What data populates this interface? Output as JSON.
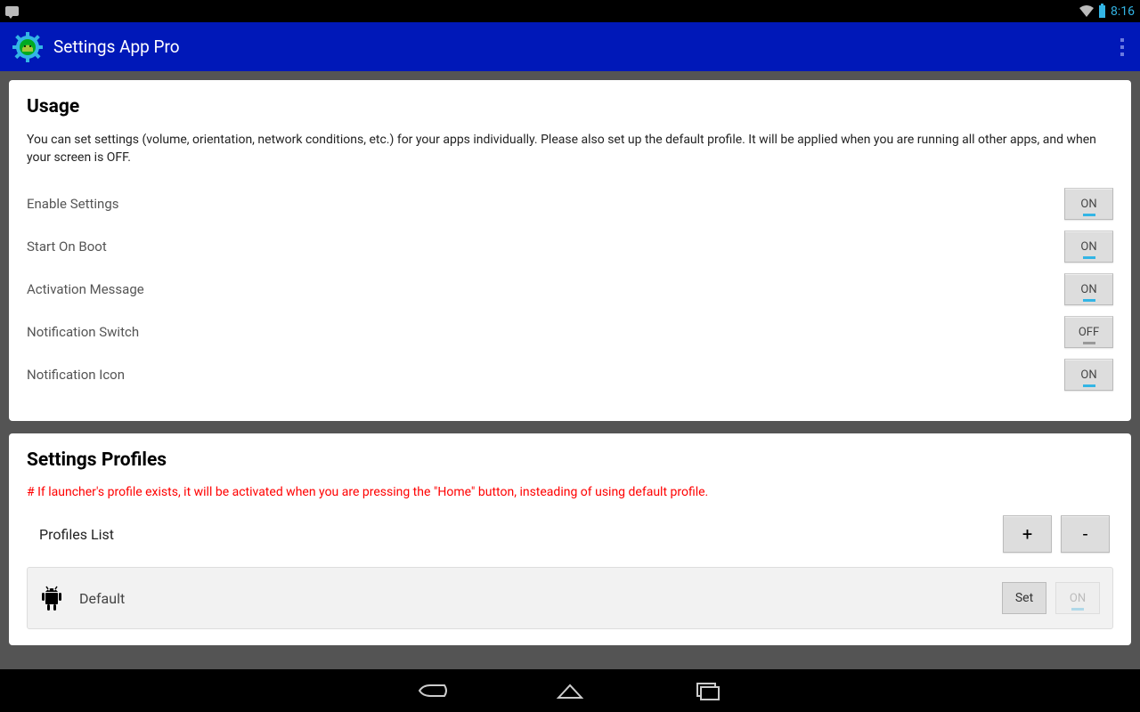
{
  "status": {
    "time": "8:16"
  },
  "appbar": {
    "title": "Settings App Pro"
  },
  "usage": {
    "heading": "Usage",
    "description": "You can set settings (volume, orientation, network conditions, etc.) for your apps individually. Please also set up the default profile. It will be applied when you are running all other apps, and when your screen is OFF.",
    "items": [
      {
        "label": "Enable Settings",
        "state": "ON"
      },
      {
        "label": "Start On Boot",
        "state": "ON"
      },
      {
        "label": "Activation Message",
        "state": "ON"
      },
      {
        "label": "Notification Switch",
        "state": "OFF"
      },
      {
        "label": "Notification Icon",
        "state": "ON"
      }
    ]
  },
  "profiles": {
    "heading": "Settings Profiles",
    "note": "# If launcher's profile exists, it will be activated when you are pressing the \"Home\" button, insteading of using default profile.",
    "list_label": "Profiles List",
    "add": "+",
    "remove": "-",
    "default_name": "Default",
    "set_label": "Set",
    "on_label": "ON"
  }
}
